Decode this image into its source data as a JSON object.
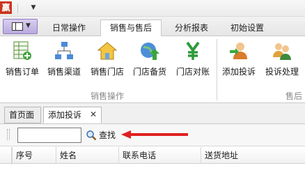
{
  "titlebar": {
    "app_icon_glyph": "贏",
    "quick_menu_icon": "dropdown-arrow-icon"
  },
  "ribbon_tabs": [
    {
      "label": "日常操作"
    },
    {
      "label": "销售与售后",
      "active": true
    },
    {
      "label": "分析报表"
    },
    {
      "label": "初始设置"
    }
  ],
  "ribbon": {
    "buttons": [
      {
        "label": "销售订单",
        "icon": "spreadsheet-add-icon"
      },
      {
        "label": "销售渠道",
        "icon": "network-icon"
      },
      {
        "label": "销售门店",
        "icon": "home-icon"
      },
      {
        "label": "门店备货",
        "icon": "globe-up-icon"
      },
      {
        "label": "门店对账",
        "icon": "yen-icon"
      },
      {
        "label": "添加投诉",
        "icon": "user-add-icon"
      },
      {
        "label": "投诉处理",
        "icon": "users-icon"
      }
    ],
    "groups": [
      {
        "label": "销售操作"
      },
      {
        "label": "售后"
      }
    ]
  },
  "doc_tabs": [
    {
      "label": "首页面"
    },
    {
      "label": "添加投诉",
      "active": true,
      "closable": true
    }
  ],
  "search": {
    "input_value": "",
    "placeholder": "",
    "button_label": "查找"
  },
  "table": {
    "columns": [
      "序号",
      "姓名",
      "联系电话",
      "送货地址"
    ],
    "rows": []
  },
  "colors": {
    "arrow": "#e02020",
    "app_icon": "#c8361c",
    "accent_purple": "#8e7cc3"
  }
}
